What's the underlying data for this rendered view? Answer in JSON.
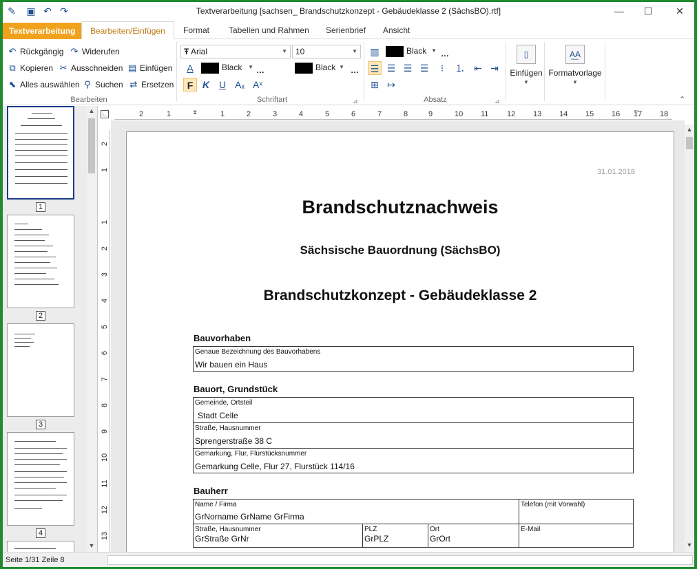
{
  "window": {
    "title": "Textverarbeitung [sachsen_ Brandschutzkonzept - Gebäudeklasse 2 (SächsBO).rtf]",
    "controls": {
      "minimize": "—",
      "maximize": "☐",
      "close": "✕"
    }
  },
  "ribbon_tabs": {
    "app": "Textverarbeitung",
    "items": [
      "Bearbeiten/Einfügen",
      "Format",
      "Tabellen und Rahmen",
      "Serienbrief",
      "Ansicht"
    ]
  },
  "bearbeiten": {
    "undo": "Rückgängig",
    "redo": "Widerufen",
    "copy": "Kopieren",
    "cut": "Ausschneiden",
    "paste": "Einfügen",
    "select_all": "Alles auswählen",
    "search": "Suchen",
    "replace": "Ersetzen",
    "label": "Bearbeiten"
  },
  "schriftart": {
    "font": "Arial",
    "size": "10",
    "font_color": "Black",
    "highlight_color": "Black",
    "bold": "F",
    "italic": "K",
    "underline": "U",
    "subscript": "Aₓ",
    "superscript": "Aˣ",
    "label": "Schriftart"
  },
  "absatz": {
    "shading_color": "Black",
    "label": "Absatz"
  },
  "insert_group": {
    "label": "Einfügen"
  },
  "style_group": {
    "label": "Formatvorlage"
  },
  "thumbnails": {
    "pages": [
      "1",
      "2",
      "3",
      "4"
    ]
  },
  "ruler": {
    "h": [
      "2",
      "1",
      "1",
      "2",
      "3",
      "4",
      "5",
      "6",
      "7",
      "8",
      "9",
      "10",
      "11",
      "12",
      "13",
      "14",
      "15",
      "16",
      "17",
      "18"
    ],
    "v": [
      "2",
      "1",
      "1",
      "2",
      "3",
      "4",
      "5",
      "6",
      "7",
      "8",
      "9",
      "10",
      "11",
      "12",
      "13"
    ]
  },
  "document": {
    "date": "31.01.2018",
    "title": "Brandschutznachweis",
    "subtitle": "Sächsische Bauordnung (SächsBO)",
    "heading": "Brandschutzkonzept - Gebäudeklasse 2",
    "bauvorhaben": {
      "section": "Bauvorhaben",
      "label": "Genaue Bezeichnung des Bauvorhabens",
      "value": "Wir bauen ein Haus"
    },
    "bauort": {
      "section": "Bauort, Grundstück",
      "gemeinde_label": "Gemeinde, Ortsteil",
      "gemeinde_value": "Stadt Celle",
      "strasse_label": "Straße, Hausnummer",
      "strasse_value": "Sprengerstraße 38 C",
      "gemarkung_label": "Gemarkung, Flur, Flurstücksnummer",
      "gemarkung_value": "Gemarkung Celle, Flur 27, Flurstück 114/16"
    },
    "bauherr": {
      "section": "Bauherr",
      "name_label": "Name / Firma",
      "name_value": "GrNorname GrName GrFirma",
      "telefon_label": "Telefon (mit Vorwahl)",
      "strasse_label": "Straße, Hausnummer",
      "strasse_value": "GrStraße GrNr",
      "plz_label": "PLZ",
      "plz_value": "GrPLZ",
      "ort_label": "Ort",
      "ort_value": "GrOrt",
      "email_label": "E-Mail"
    }
  },
  "status": {
    "text": "Seite 1/31 Zeile 8"
  }
}
